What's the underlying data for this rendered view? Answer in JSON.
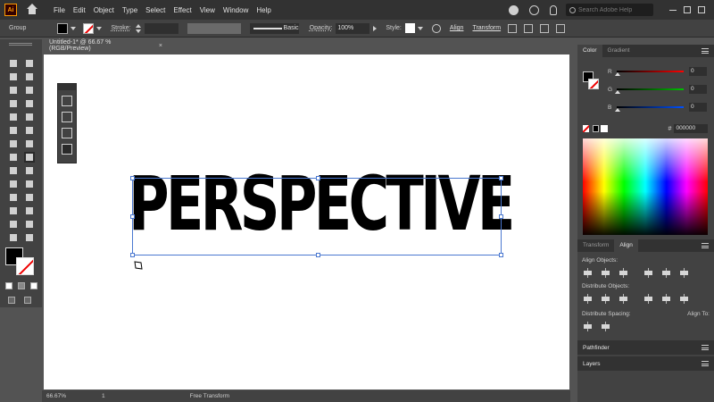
{
  "menubar": {
    "logo": "Ai",
    "items": [
      "File",
      "Edit",
      "Object",
      "Type",
      "Select",
      "Effect",
      "View",
      "Window",
      "Help"
    ],
    "search_placeholder": "Search Adobe Help"
  },
  "controlbar": {
    "selection": "Group",
    "stroke_label": "Stroke:",
    "brush": "Basic",
    "opacity_label": "Opacity:",
    "opacity_value": "100%",
    "style_label": "Style:",
    "align_link": "Align",
    "transform_link": "Transform"
  },
  "document": {
    "tab_title": "Untitled-1* @ 66.67 % (RGB/Preview)",
    "tab_close": "×"
  },
  "artwork": {
    "text": "PERSPECTIVE"
  },
  "statusbar": {
    "zoom": "66.67%",
    "page": "1",
    "tool": "Free Transform"
  },
  "color_panel": {
    "tabs": [
      "Color",
      "Gradient"
    ],
    "channels": [
      {
        "label": "R",
        "value": "0",
        "color": "#ff0000"
      },
      {
        "label": "G",
        "value": "0",
        "color": "#00c000"
      },
      {
        "label": "B",
        "value": "0",
        "color": "#0050ff"
      }
    ],
    "hex_label": "#",
    "hex_value": "000000"
  },
  "align_panel": {
    "tabs": [
      "Transform",
      "Align"
    ],
    "align_objects": "Align Objects:",
    "distribute_objects": "Distribute Objects:",
    "distribute_spacing": "Distribute Spacing:",
    "align_to": "Align To:"
  },
  "collapsed_panels": [
    "Pathfinder",
    "Layers"
  ]
}
